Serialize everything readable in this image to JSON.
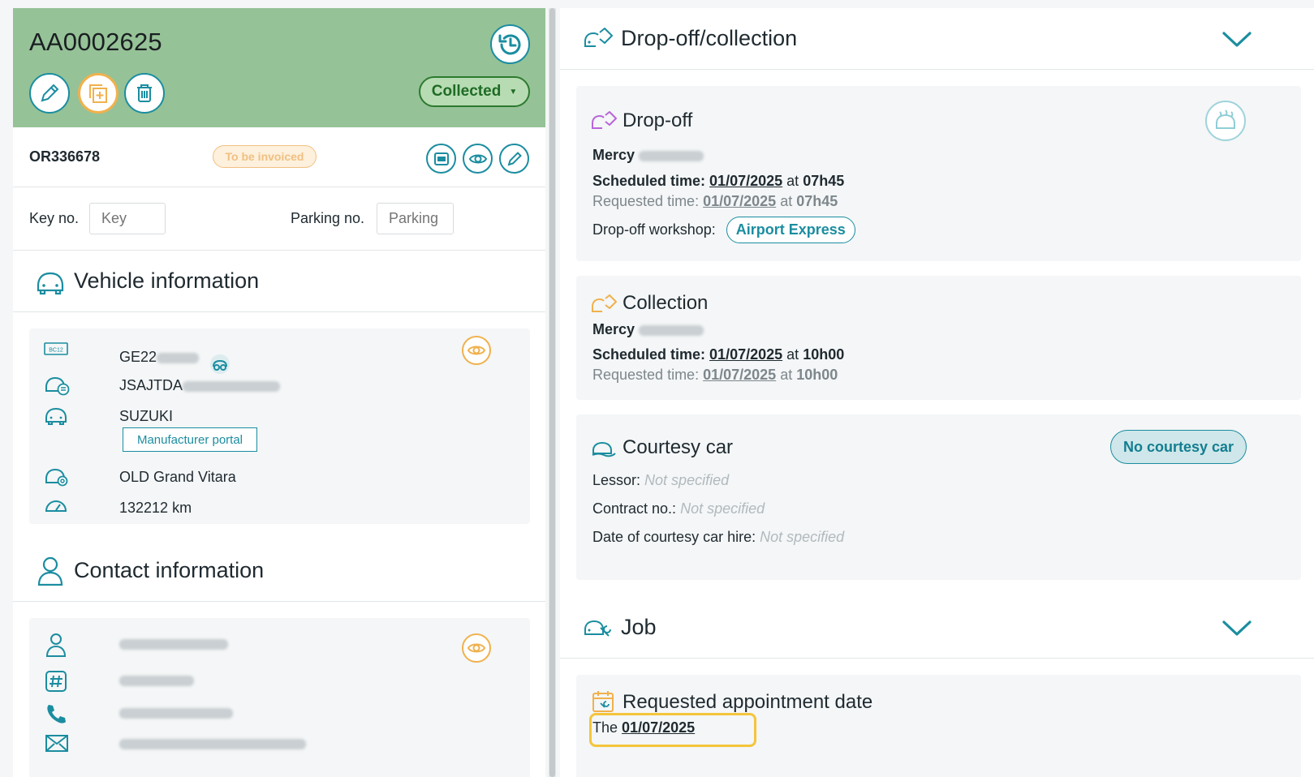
{
  "order": {
    "id": "AA0002625",
    "status": "Collected",
    "or_number": "OR336678",
    "invoice_badge": "To be invoiced"
  },
  "fields": {
    "key_label": "Key no.",
    "key_placeholder": "Key",
    "parking_label": "Parking no.",
    "parking_placeholder": "Parking"
  },
  "vehicle": {
    "title": "Vehicle information",
    "plate_prefix": "GE22",
    "vin_prefix": "JSAJTDA",
    "make": "SUZUKI",
    "manufacturer_portal": "Manufacturer portal",
    "model": "OLD Grand Vitara",
    "mileage": "132212 km"
  },
  "contact": {
    "title": "Contact information"
  },
  "dropoff_collection": {
    "title": "Drop-off/collection",
    "dropoff": {
      "title": "Drop-off",
      "person": "Mercy",
      "scheduled_label": "Scheduled time:",
      "scheduled_date": "01/07/2025",
      "at": "at",
      "scheduled_time": "07h45",
      "requested_label": "Requested time:",
      "requested_date": "01/07/2025",
      "requested_time": "07h45",
      "workshop_label": "Drop-off workshop:",
      "workshop": "Airport Express"
    },
    "collection": {
      "title": "Collection",
      "person": "Mercy",
      "scheduled_label": "Scheduled time:",
      "scheduled_date": "01/07/2025",
      "at": "at",
      "scheduled_time": "10h00",
      "requested_label": "Requested time:",
      "requested_date": "01/07/2025",
      "requested_time": "10h00"
    },
    "courtesy": {
      "title": "Courtesy car",
      "badge": "No courtesy car",
      "lessor_label": "Lessor:",
      "contract_label": "Contract no.:",
      "hire_label": "Date of courtesy car hire:",
      "not_specified": "Not specified"
    }
  },
  "job": {
    "title": "Job",
    "appointment_title": "Requested appointment date",
    "the": "The",
    "appointment_date": "01/07/2025"
  },
  "colors": {
    "header_green": "#96c297",
    "accent_teal": "#1b8da0",
    "accent_orange": "#f0b14d",
    "highlight_yellow": "#f4c53c"
  }
}
